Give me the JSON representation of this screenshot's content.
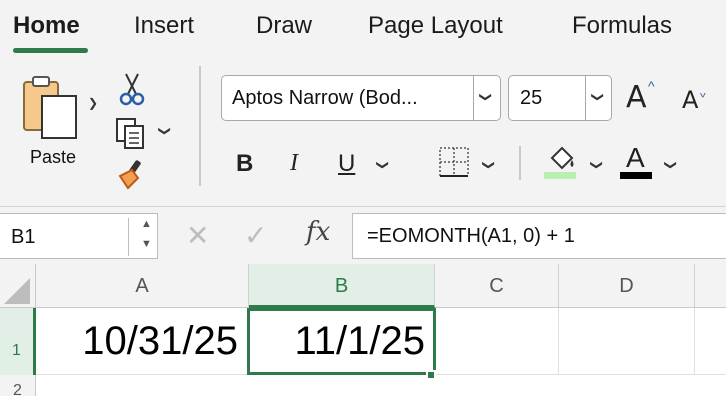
{
  "tabs": [
    {
      "label": "Home",
      "active": true
    },
    {
      "label": "Insert"
    },
    {
      "label": "Draw"
    },
    {
      "label": "Page Layout"
    },
    {
      "label": "Formulas"
    }
  ],
  "ribbon": {
    "paste_label": "Paste",
    "font_name": "Aptos Narrow (Bod...",
    "font_size": "25",
    "bold_label": "B",
    "italic_label": "I",
    "underline_label": "U",
    "grow_font_label": "A",
    "shrink_font_label": "A",
    "font_color_label": "A",
    "fill_color": "#b8f0b0",
    "font_color": "#000000"
  },
  "formula_bar": {
    "name_box": "B1",
    "fx_label": "fx",
    "formula": "=EOMONTH(A1, 0) + 1"
  },
  "grid": {
    "columns": [
      "A",
      "B",
      "C",
      "D"
    ],
    "selected_column": "B",
    "rows": [
      "1",
      "2"
    ],
    "cells": {
      "A1": "10/31/25",
      "B1": "11/1/25"
    }
  },
  "colors": {
    "accent": "#2f7a4a",
    "ribbon_bg": "#f3f3f3"
  }
}
